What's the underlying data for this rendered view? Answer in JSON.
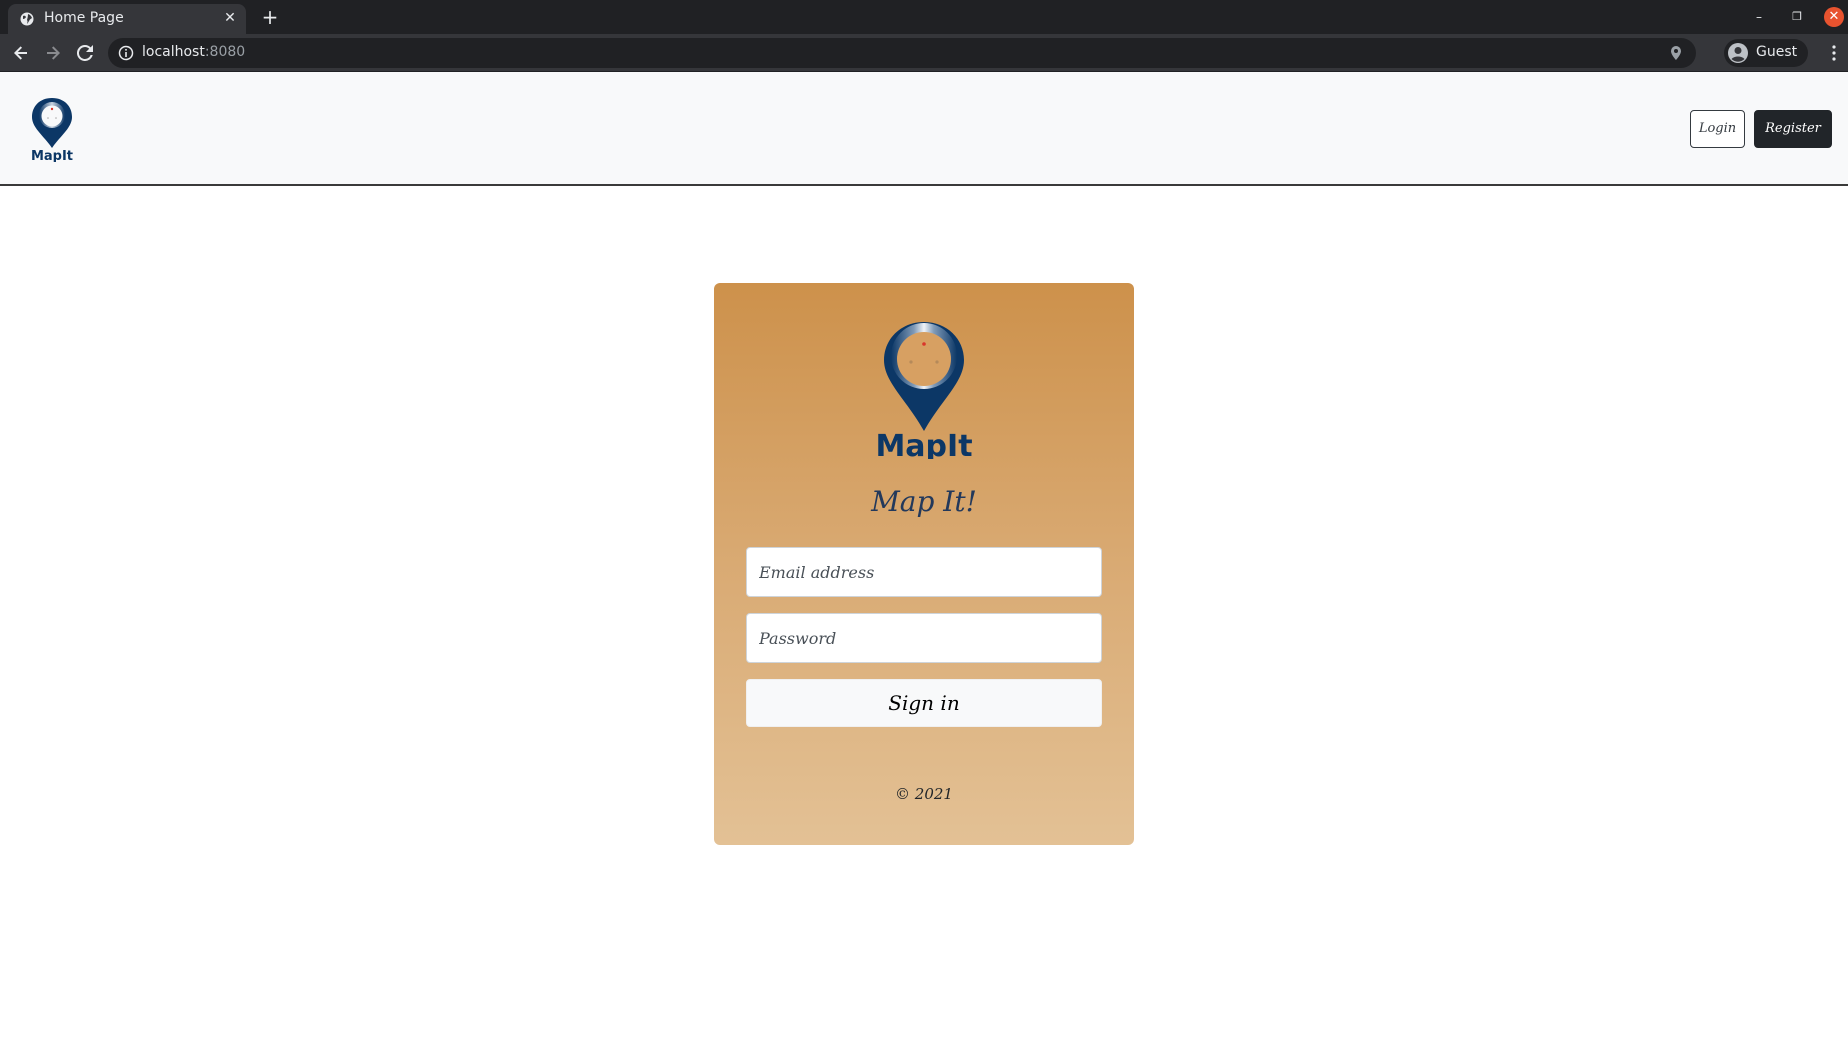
{
  "browser": {
    "tab_title": "Home Page",
    "tab_close": "✕",
    "new_tab": "+",
    "url_host": "localhost",
    "url_port": ":8080",
    "profile_label": "Guest",
    "window_minimize": "–",
    "window_maximize": "❐",
    "window_close": "✕"
  },
  "navbar": {
    "login_label": "Login",
    "register_label": "Register"
  },
  "logo": {
    "brand_text": "MapIt"
  },
  "login_card": {
    "title": "Map It!",
    "email_placeholder": "Email address",
    "password_placeholder": "Password",
    "signin_label": "Sign in",
    "copyright": "© 2021"
  },
  "colors": {
    "navy": "#0c3766",
    "card_top": "#cd914b",
    "card_bottom": "#e3c195",
    "accent_red": "#d9362b"
  }
}
